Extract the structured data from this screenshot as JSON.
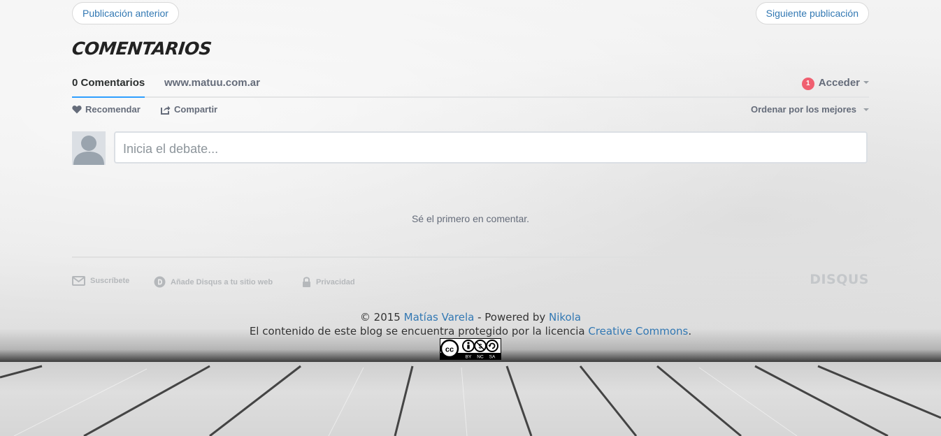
{
  "pagination": {
    "prev_label": "Publicación anterior",
    "next_label": "Siguiente publicación"
  },
  "comments_section": {
    "title": "COMENTARIOS",
    "tabs": [
      {
        "label": "0 Comentarios",
        "active": true
      },
      {
        "label": "www.matuu.com.ar",
        "active": false
      }
    ],
    "login": {
      "badge": "1",
      "label": "Acceder"
    },
    "recommend_label": "Recomendar",
    "share_label": "Compartir",
    "sort_label": "Ordenar por los mejores",
    "composer_placeholder": "Inicia el debate...",
    "empty_message": "Sé el primero en comentar.",
    "footer": {
      "subscribe_label": "Suscríbete",
      "add_label": "Añade Disqus a tu sitio web",
      "privacy_label": "Privacidad",
      "brand": "DISQUS"
    }
  },
  "site_footer": {
    "copyright_prefix": "© 2015",
    "author": "Matías Varela",
    "powered_by": "- Powered by",
    "engine": "Nikola",
    "license_text": "El contenido de este blog se encuentra protegido por la licencia",
    "license_link": "Creative Commons",
    "license_suffix": ".",
    "badge_terms": [
      "BY",
      "NC",
      "SA"
    ]
  },
  "colors": {
    "link": "#3278b3",
    "badge": "#f05f70",
    "tab_underline": "#2e9fff"
  }
}
